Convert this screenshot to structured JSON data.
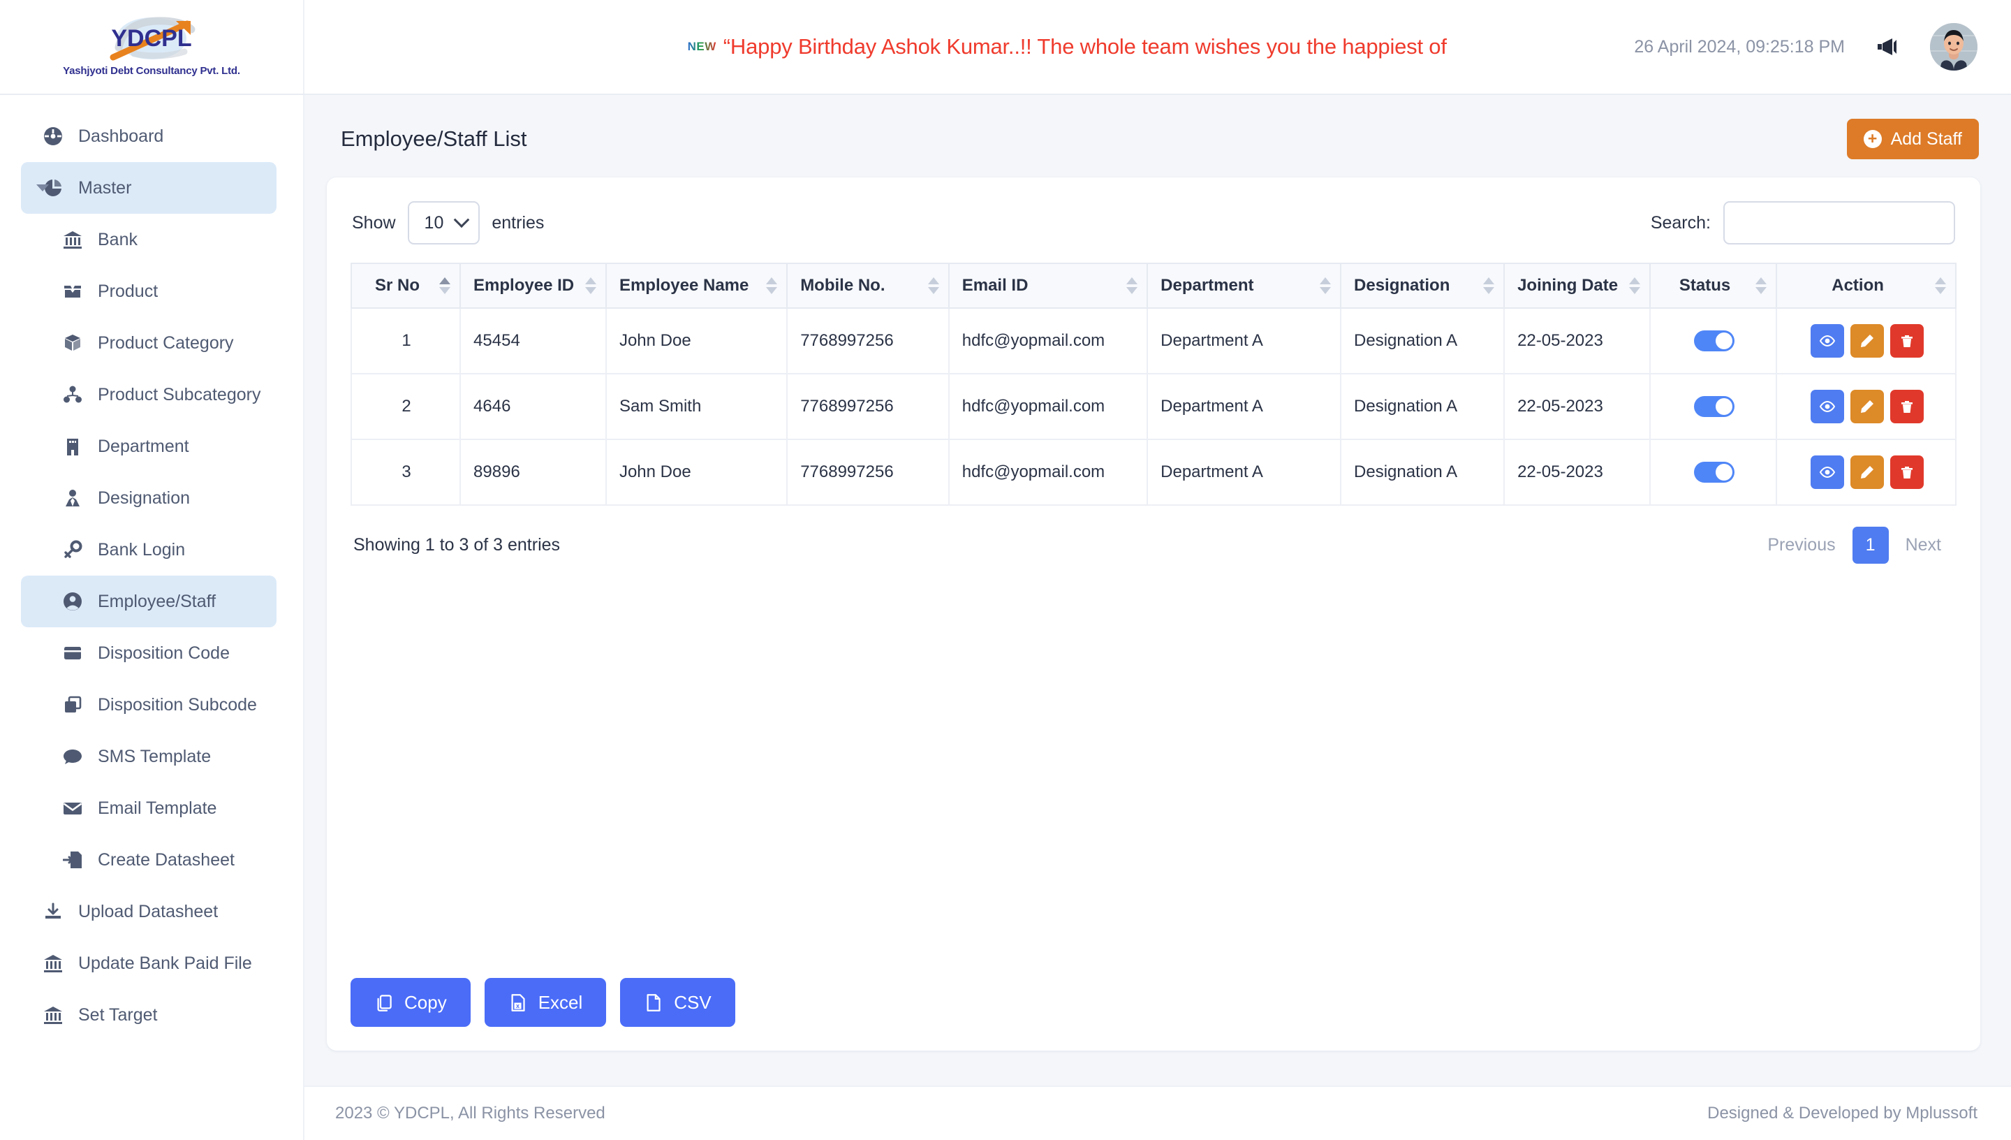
{
  "brand": {
    "logo_text": "YDCPL",
    "tagline": "Yashjyoti Debt Consultancy Pvt. Ltd."
  },
  "topbar": {
    "new_badge": "NEW",
    "marquee_text": "“Happy Birthday Ashok Kumar..!! The whole team wishes you the happiest of",
    "datetime": "26 April 2024, 09:25:18 PM",
    "bullhorn_icon": "bullhorn-icon",
    "avatar_icon": "user-avatar"
  },
  "sidebar": {
    "items": [
      {
        "label": "Dashboard",
        "icon": "dashboard-icon",
        "level": "top",
        "active": false
      },
      {
        "label": "Master",
        "icon": "pie-chart-icon",
        "level": "top",
        "active": true,
        "caret": true
      },
      {
        "label": "Bank",
        "icon": "bank-icon",
        "level": "sub",
        "active": false
      },
      {
        "label": "Product",
        "icon": "open-box-icon",
        "level": "sub",
        "active": false
      },
      {
        "label": "Product Category",
        "icon": "box-icon",
        "level": "sub",
        "active": false
      },
      {
        "label": "Product Subcategory",
        "icon": "sitemap-icon",
        "level": "sub",
        "active": false
      },
      {
        "label": "Department",
        "icon": "building-icon",
        "level": "sub",
        "active": false
      },
      {
        "label": "Designation",
        "icon": "user-tie-icon",
        "level": "sub",
        "active": false
      },
      {
        "label": "Bank Login",
        "icon": "key-icon",
        "level": "sub",
        "active": false
      },
      {
        "label": "Employee/Staff",
        "icon": "user-circle-icon",
        "level": "sub",
        "active": true
      },
      {
        "label": "Disposition Code",
        "icon": "card-icon",
        "level": "sub",
        "active": false
      },
      {
        "label": "Disposition Subcode",
        "icon": "clone-icon",
        "level": "sub",
        "active": false
      },
      {
        "label": "SMS Template",
        "icon": "comment-icon",
        "level": "sub",
        "active": false
      },
      {
        "label": "Email Template",
        "icon": "envelope-icon",
        "level": "sub",
        "active": false
      },
      {
        "label": "Create Datasheet",
        "icon": "file-import-icon",
        "level": "sub",
        "active": false
      },
      {
        "label": "Upload Datasheet",
        "icon": "download-icon",
        "level": "top",
        "active": false
      },
      {
        "label": "Update Bank Paid File",
        "icon": "bank-icon",
        "level": "top",
        "active": false
      },
      {
        "label": "Set Target",
        "icon": "bank-icon",
        "level": "top",
        "active": false
      }
    ]
  },
  "page": {
    "title": "Employee/Staff List",
    "add_button": "Add Staff"
  },
  "controls": {
    "show_label": "Show",
    "entries_label": "entries",
    "page_size": "10",
    "search_label": "Search:",
    "search_value": "",
    "search_placeholder": ""
  },
  "table": {
    "columns": [
      {
        "label": "Sr No",
        "align": "center",
        "sorted": "asc"
      },
      {
        "label": "Employee ID",
        "align": "left",
        "sorted": "none"
      },
      {
        "label": "Employee Name",
        "align": "left",
        "sorted": "none"
      },
      {
        "label": "Mobile No.",
        "align": "left",
        "sorted": "none"
      },
      {
        "label": "Email ID",
        "align": "left",
        "sorted": "none"
      },
      {
        "label": "Department",
        "align": "left",
        "sorted": "none"
      },
      {
        "label": "Designation",
        "align": "left",
        "sorted": "none"
      },
      {
        "label": "Joining Date",
        "align": "left",
        "sorted": "none"
      },
      {
        "label": "Status",
        "align": "center",
        "sorted": "none"
      },
      {
        "label": "Action",
        "align": "center",
        "sorted": "none"
      }
    ],
    "rows": [
      {
        "sr_no": "1",
        "employee_id": "45454",
        "employee_name": "John Doe",
        "mobile_no": "7768997256",
        "email_id": "hdfc@yopmail.com",
        "department": "Department A",
        "designation": "Designation A",
        "joining_date": "22-05-2023",
        "status_on": true
      },
      {
        "sr_no": "2",
        "employee_id": "4646",
        "employee_name": "Sam Smith",
        "mobile_no": "7768997256",
        "email_id": "hdfc@yopmail.com",
        "department": "Department A",
        "designation": "Designation A",
        "joining_date": "22-05-2023",
        "status_on": true
      },
      {
        "sr_no": "3",
        "employee_id": "89896",
        "employee_name": "John Doe",
        "mobile_no": "7768997256",
        "email_id": "hdfc@yopmail.com",
        "department": "Department A",
        "designation": "Designation A",
        "joining_date": "22-05-2023",
        "status_on": true
      }
    ],
    "action_icons": [
      "eye-icon",
      "pencil-icon",
      "trash-icon"
    ],
    "showing_text": "Showing 1 to 3 of 3 entries",
    "pagination": {
      "previous": "Previous",
      "current": "1",
      "next": "Next"
    }
  },
  "exports": [
    {
      "label": "Copy",
      "icon": "copy-icon"
    },
    {
      "label": "Excel",
      "icon": "file-excel-icon"
    },
    {
      "label": "CSV",
      "icon": "file-csv-icon"
    }
  ],
  "footer": {
    "left": "2023 © YDCPL, All Rights Reserved",
    "right": "Designed & Developed by Mplussoft"
  },
  "colors": {
    "accent_orange": "#dd7b28",
    "accent_blue": "#4a6cf7",
    "danger_red": "#e0392b",
    "active_nav": "#dceaf8",
    "marquee_red": "#ef3b2d"
  }
}
